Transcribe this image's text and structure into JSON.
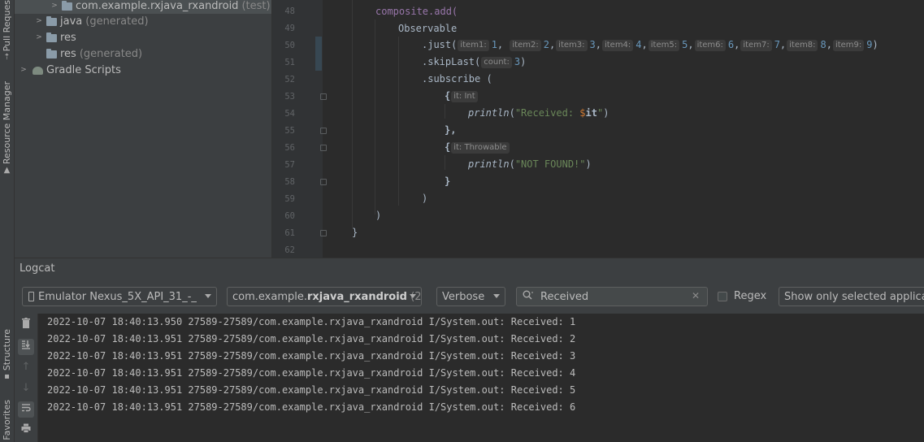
{
  "left_strip": {
    "pull_requests": "Pull Reques",
    "resource_manager": "Resource Manager",
    "structure": "Structure",
    "favorites": "Favorites"
  },
  "project_tree": [
    {
      "name": "com.example.rxjava_rxandroid",
      "suffix": "(test)",
      "chevron": ">",
      "selected": true
    },
    {
      "name": "java",
      "suffix": "(generated)",
      "chevron": ">",
      "selected": false
    },
    {
      "name": "res",
      "suffix": "",
      "chevron": ">",
      "selected": false
    },
    {
      "name": "res",
      "suffix": "(generated)",
      "chevron": "",
      "selected": false
    },
    {
      "name": "Gradle Scripts",
      "suffix": "",
      "chevron": ">",
      "selected": false
    }
  ],
  "editor": {
    "line_numbers": [
      "48",
      "49",
      "50",
      "51",
      "52",
      "53",
      "54",
      "55",
      "56",
      "57",
      "58",
      "59",
      "60",
      "61",
      "62"
    ],
    "hints": {
      "item1": "item1:",
      "item2": "item2:",
      "item3": "item3:",
      "item4": "item4:",
      "item5": "item5:",
      "item6": "item6:",
      "item7": "item7:",
      "item8": "item8:",
      "item9": "item9:",
      "count": "count:",
      "it_int": "it: Int",
      "it_throwable": "it: Throwable"
    },
    "code": {
      "l48": "composite.add(",
      "l49": "Observable",
      "l50_start": ".just(",
      "l50_vals": [
        "1",
        "2",
        "3",
        "4",
        "5",
        "6",
        "7",
        "8",
        "9"
      ],
      "l51_start": ".skipLast(",
      "l51_val": "3",
      "l51_end": ")",
      "l52": ".subscribe (",
      "l53": "{",
      "l54_fn": "println",
      "l54_str1": "\"Received: ",
      "l54_tmpl": "$",
      "l54_var": "it",
      "l54_str2": "\"",
      "l55": "},",
      "l56": "{",
      "l57_fn": "println",
      "l57_str": "\"NOT FOUND!\"",
      "l58": "}",
      "l59": ")",
      "l60": ")",
      "l61": "}"
    }
  },
  "logcat": {
    "title": "Logcat",
    "device": "Emulator Nexus_5X_API_31_-_",
    "process_prefix": "com.example.",
    "process_bold": "rxjava_rxandroid",
    "process_suffix": " (2",
    "level": "Verbose",
    "search_value": "Received",
    "regex_label": "Regex",
    "filter_label": "Show only selected applicatio",
    "lines": [
      "2022-10-07 18:40:13.950 27589-27589/com.example.rxjava_rxandroid I/System.out: Received: 1",
      "2022-10-07 18:40:13.951 27589-27589/com.example.rxjava_rxandroid I/System.out: Received: 2",
      "2022-10-07 18:40:13.951 27589-27589/com.example.rxjava_rxandroid I/System.out: Received: 3",
      "2022-10-07 18:40:13.951 27589-27589/com.example.rxjava_rxandroid I/System.out: Received: 4",
      "2022-10-07 18:40:13.951 27589-27589/com.example.rxjava_rxandroid I/System.out: Received: 5",
      "2022-10-07 18:40:13.951 27589-27589/com.example.rxjava_rxandroid I/System.out: Received: 6"
    ]
  }
}
